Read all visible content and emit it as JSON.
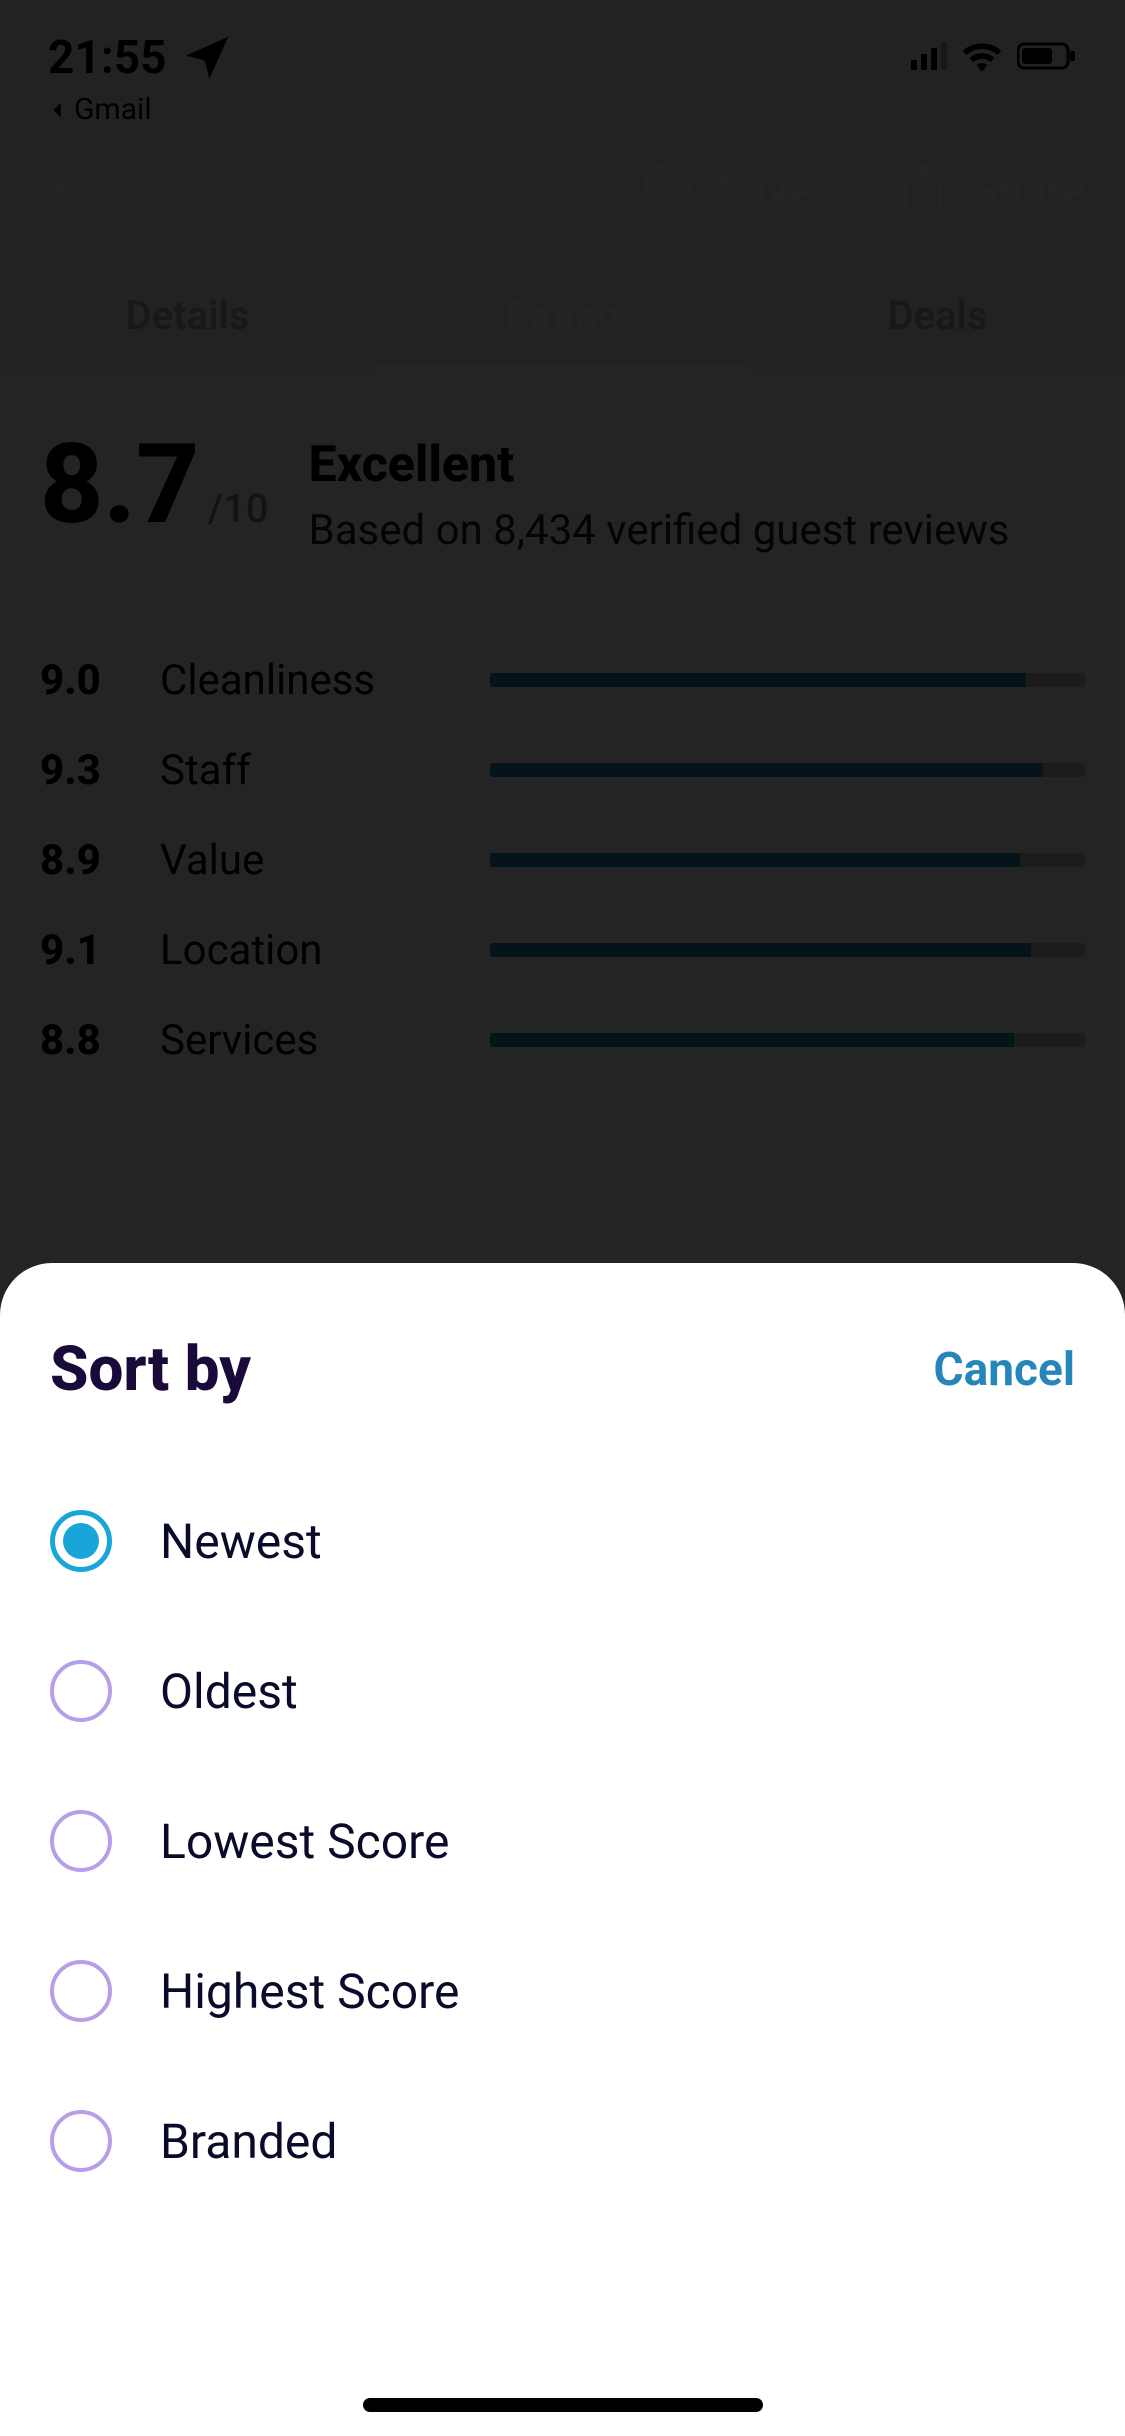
{
  "status": {
    "time": "21:55",
    "back_app": "Gmail"
  },
  "topnav": {
    "save_label": "Save",
    "share_label": "Share"
  },
  "tabs": {
    "details": "Details",
    "rating": "Rating",
    "deals": "Deals"
  },
  "rating": {
    "score": "8.7",
    "out_of": "/10",
    "label": "Excellent",
    "sub": "Based on 8,434 verified guest reviews",
    "rows": [
      {
        "value": "9.0",
        "label": "Cleanliness",
        "pct": 90
      },
      {
        "value": "9.3",
        "label": "Staff",
        "pct": 93
      },
      {
        "value": "8.9",
        "label": "Value",
        "pct": 89
      },
      {
        "value": "9.1",
        "label": "Location",
        "pct": 91
      },
      {
        "value": "8.8",
        "label": "Services",
        "pct": 88
      }
    ]
  },
  "sheet": {
    "title": "Sort by",
    "cancel": "Cancel",
    "options": [
      {
        "label": "Newest",
        "selected": true
      },
      {
        "label": "Oldest",
        "selected": false
      },
      {
        "label": "Lowest Score",
        "selected": false
      },
      {
        "label": "Highest Score",
        "selected": false
      },
      {
        "label": "Branded",
        "selected": false
      }
    ]
  }
}
